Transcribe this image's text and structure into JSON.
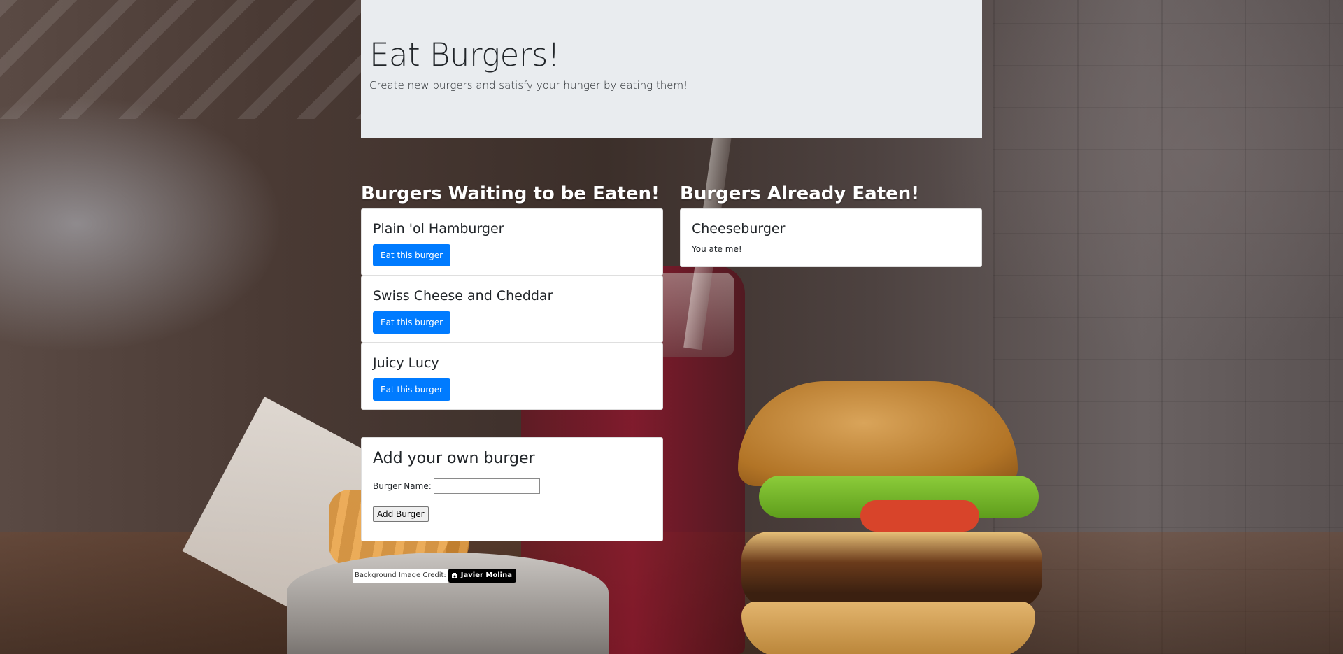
{
  "jumbotron": {
    "title": "Eat Burgers!",
    "subtitle": "Create new burgers and satisfy your hunger by eating them!"
  },
  "waiting": {
    "heading": "Burgers Waiting to be Eaten!",
    "button_label": "Eat this burger",
    "items": [
      {
        "name": "Plain 'ol Hamburger"
      },
      {
        "name": "Swiss Cheese and Cheddar"
      },
      {
        "name": "Juicy Lucy"
      }
    ]
  },
  "eaten": {
    "heading": "Burgers Already Eaten!",
    "items": [
      {
        "name": "Cheeseburger",
        "note": "You ate me!"
      }
    ]
  },
  "add_form": {
    "heading": "Add your own burger",
    "field_label": "Burger Name:",
    "field_value": "",
    "button_label": "Add Burger"
  },
  "credit": {
    "label": "Background Image Credit:",
    "author": "Javier Molina",
    "icon": "camera-icon"
  },
  "colors": {
    "primary_button": "#007bff",
    "jumbotron_bg": "#e9ecef"
  }
}
